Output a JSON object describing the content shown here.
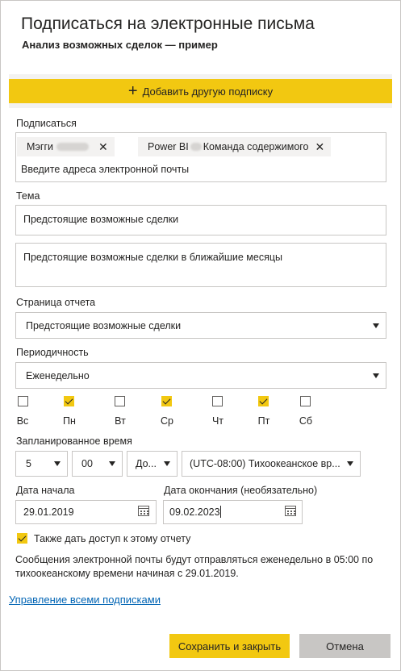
{
  "dialog": {
    "title": "Подписаться на электронные письма",
    "subtitle": "Анализ возможных сделок — пример"
  },
  "add_subscription_label": "Добавить другую подписку",
  "subscribe": {
    "label": "Подписаться",
    "recipients": [
      {
        "name": "Мэгги"
      },
      {
        "name_prefix": "Power BI",
        "name_suffix": "Команда содержимого"
      }
    ],
    "placeholder": "Введите адреса электронной почты"
  },
  "subject": {
    "label": "Тема",
    "value": "Предстоящие возможные сделки"
  },
  "message": {
    "value": "Предстоящие возможные сделки в ближайшие месяцы"
  },
  "report_page": {
    "label": "Страница отчета",
    "value": "Предстоящие возможные сделки"
  },
  "frequency": {
    "label": "Периодичность",
    "value": "Еженедельно"
  },
  "days": [
    {
      "label": "Вс",
      "checked": false
    },
    {
      "label": "Пн",
      "checked": true
    },
    {
      "label": "Вт",
      "checked": false
    },
    {
      "label": "Ср",
      "checked": true
    },
    {
      "label": "Чт",
      "checked": false
    },
    {
      "label": "Пт",
      "checked": true
    },
    {
      "label": "Сб",
      "checked": false
    }
  ],
  "scheduled_time": {
    "label": "Запланированное время",
    "hour": "5",
    "minute": "00",
    "ampm": "До...",
    "timezone": "(UTC-08:00) Тихоокеанское вр..."
  },
  "start_date": {
    "label": "Дата начала",
    "value": "29.01.2019"
  },
  "end_date": {
    "label": "Дата окончания (необязательно)",
    "value": "09.02.2023"
  },
  "share_access": {
    "label": "Также дать доступ к этому отчету",
    "checked": true
  },
  "note": "Сообщения электронной почты будут отправляться еженедельно в 05:00 по тихоокеанскому времени начиная с 29.01.2019.",
  "manage_link": "Управление всеми подписками",
  "buttons": {
    "save": "Сохранить и закрыть",
    "cancel": "Отмена"
  },
  "colors": {
    "accent": "#f2c811",
    "link": "#0064b4"
  }
}
